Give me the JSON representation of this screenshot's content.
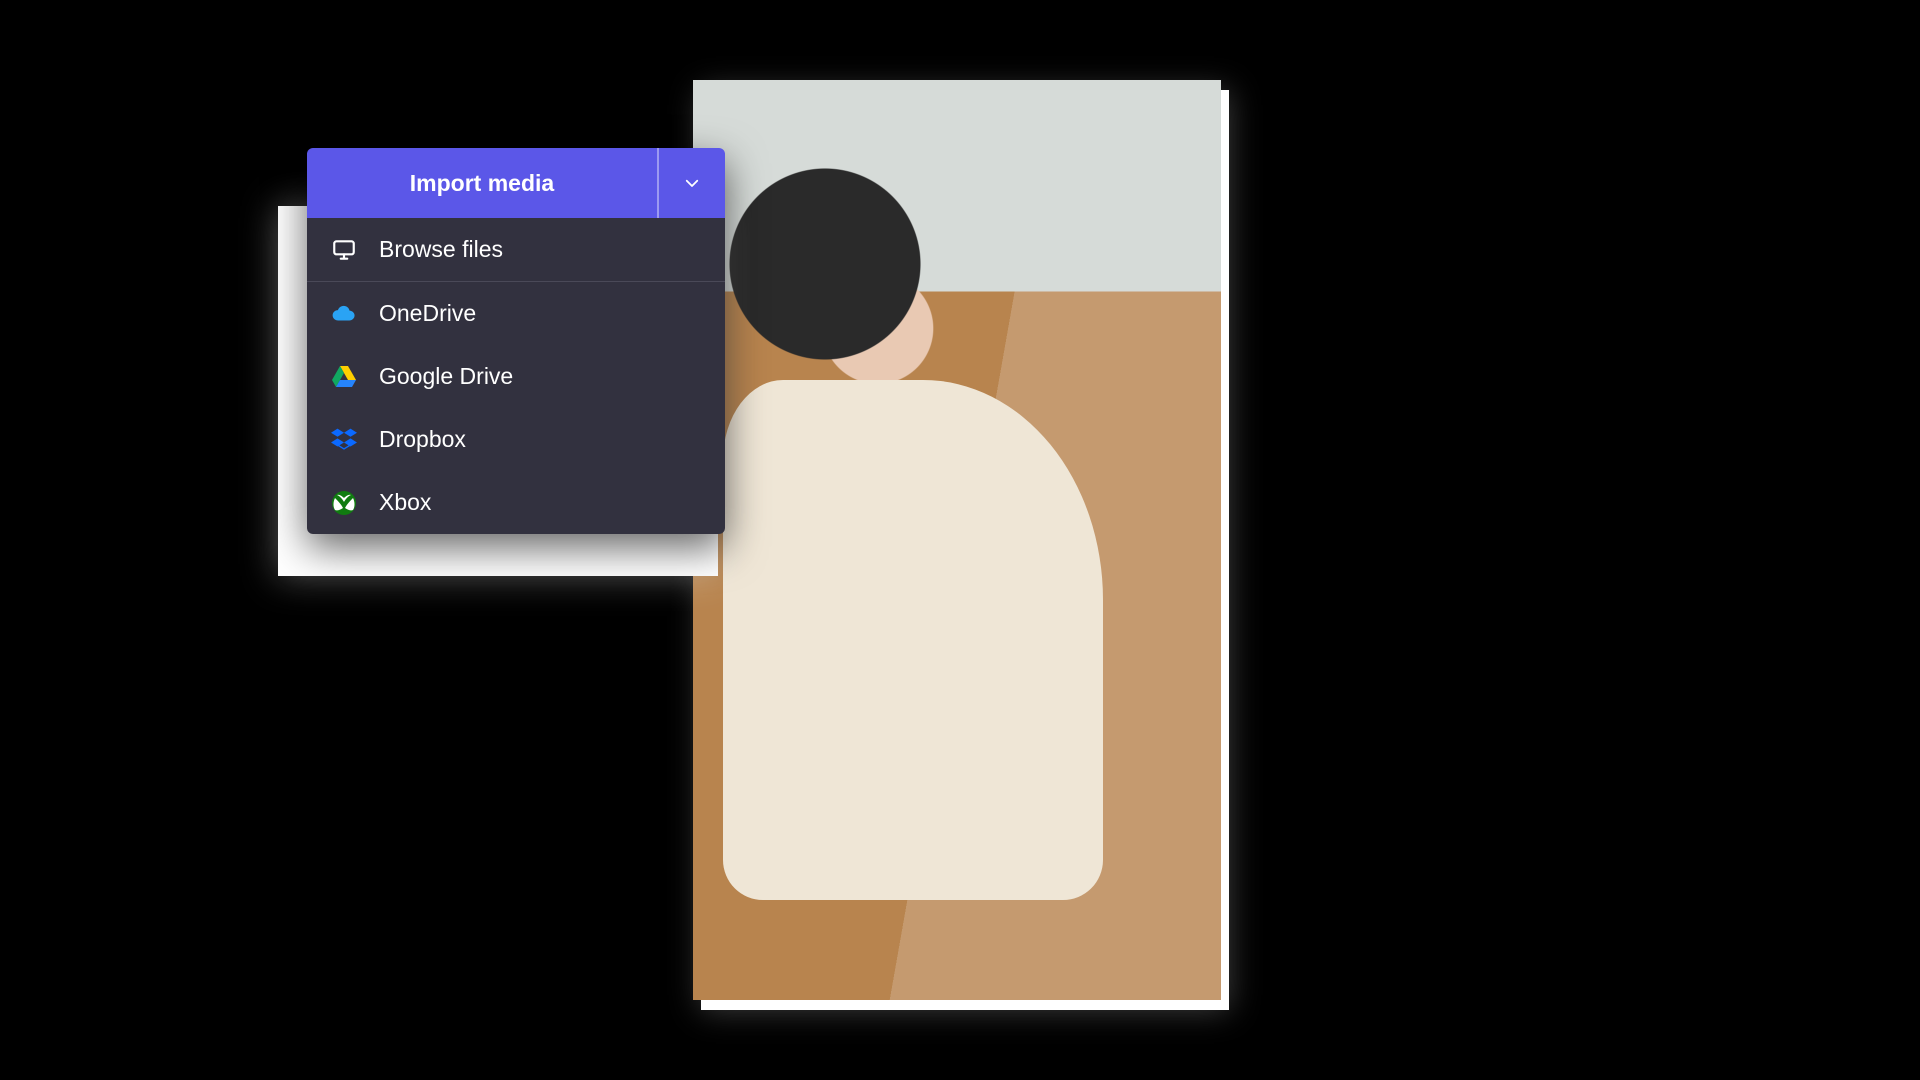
{
  "header": {
    "title": "Import media"
  },
  "items": [
    {
      "icon": "monitor",
      "label": "Browse files"
    },
    {
      "icon": "onedrive",
      "label": "OneDrive"
    },
    {
      "icon": "googledrive",
      "label": "Google Drive"
    },
    {
      "icon": "dropbox",
      "label": "Dropbox"
    },
    {
      "icon": "xbox",
      "label": "Xbox"
    }
  ],
  "photo_alt": "Woman in cream sweater opening a cardboard box on an orange couch"
}
